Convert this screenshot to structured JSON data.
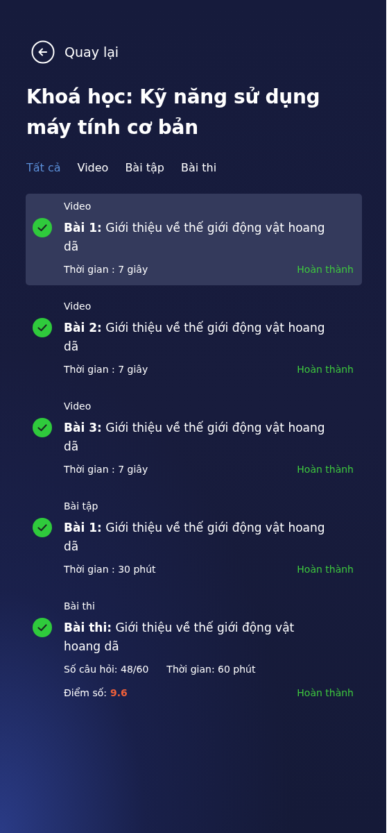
{
  "back": {
    "label": "Quay lại"
  },
  "title": "Khoá học: Kỹ năng sử dụng máy tính cơ bản",
  "tabs": [
    {
      "label": "Tất cả",
      "selected": true
    },
    {
      "label": "Video",
      "selected": false
    },
    {
      "label": "Bài tập",
      "selected": false
    },
    {
      "label": "Bài thi",
      "selected": false
    }
  ],
  "lessons": [
    {
      "kind": "lesson",
      "selected": true,
      "completed": true,
      "type_label": "Video",
      "title": "**Bài 1:** Giới thiệu về thế giới động vật hoang dã",
      "duration": "Thời gian : 7 giây",
      "status": "Hoàn thành"
    },
    {
      "kind": "lesson",
      "selected": false,
      "completed": true,
      "type_label": "Video",
      "title": "**Bài 2:** Giới thiệu về thế giới động vật hoang dã",
      "duration": "Thời gian : 7 giây",
      "status": "Hoàn thành"
    },
    {
      "kind": "lesson",
      "selected": false,
      "completed": true,
      "type_label": "Video",
      "title": "**Bài 3:** Giới thiệu về thế giới động vật hoang dã",
      "duration": "Thời gian : 7 giây",
      "status": "Hoàn thành"
    },
    {
      "kind": "lesson",
      "selected": false,
      "completed": true,
      "type_label": "Bài tập",
      "title": "**Bài 1:** Giới thiệu về thế giới động vật hoang dã",
      "duration": "Thời gian : 30 phút",
      "status": "Hoàn thành"
    },
    {
      "kind": "exam",
      "selected": false,
      "completed": true,
      "type_label": "Bài thi",
      "title": "**Bài thi:** Giới thiệu về thế giới động vật hoang dã",
      "questions": "Số câu hỏi: 48/60",
      "duration": "Thời gian: 60 phút",
      "score_label": "Điểm số:",
      "score": "9.6",
      "status": "Hoàn thành"
    }
  ]
}
